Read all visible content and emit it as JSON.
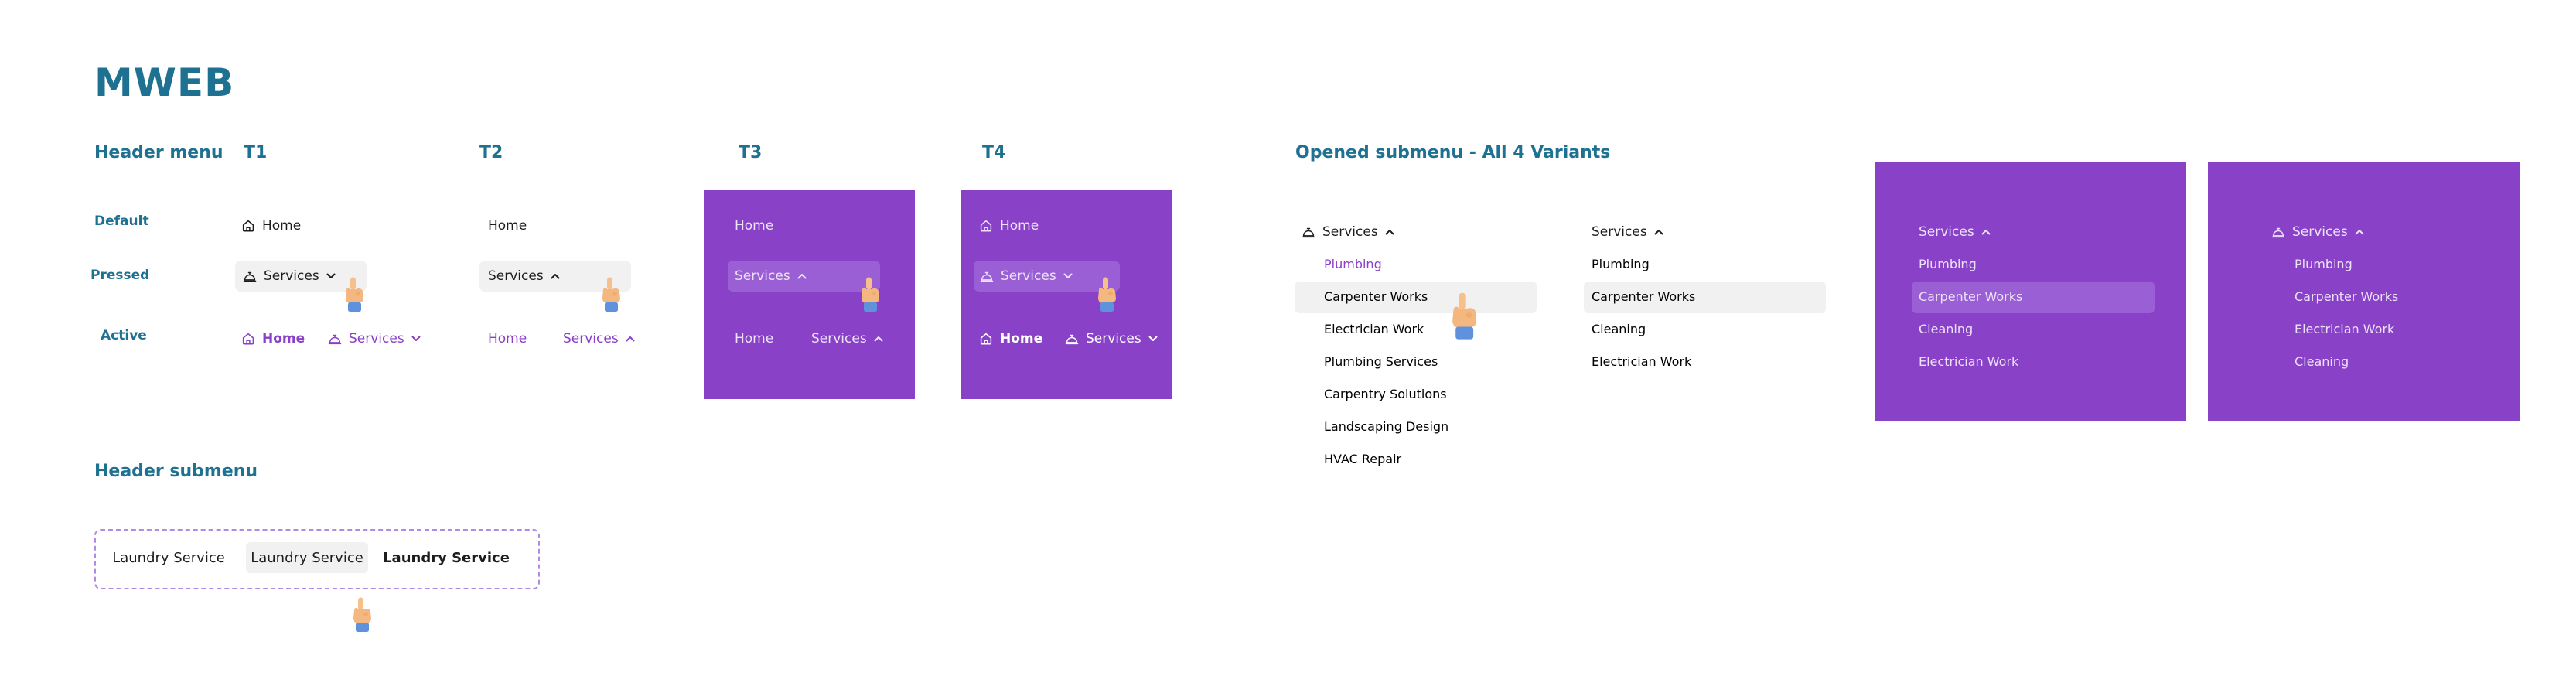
{
  "page_title": "MWEB",
  "sections": {
    "header_menu": "Header menu",
    "t1": "T1",
    "t2": "T2",
    "t3": "T3",
    "t4": "T4",
    "opened_submenu": "Opened submenu - All 4 Variants",
    "header_submenu": "Header submenu"
  },
  "row_labels": {
    "default": "Default",
    "pressed": "Pressed",
    "active": "Active"
  },
  "nav": {
    "home": "Home",
    "services": "Services"
  },
  "submenu_variant_1": [
    "Plumbing",
    "Carpenter Works",
    "Electrician Work",
    "Plumbing Services",
    "Carpentry Solutions",
    "Landscaping Design",
    "HVAC Repair"
  ],
  "submenu_variant_2": [
    "Plumbing",
    "Carpenter Works",
    "Cleaning",
    "Electrician Work"
  ],
  "submenu_variant_3": [
    "Plumbing",
    "Carpenter Works",
    "Cleaning",
    "Electrician Work"
  ],
  "submenu_variant_4": [
    "Plumbing",
    "Carpenter Works",
    "Electrician Work",
    "Cleaning"
  ],
  "header_submenu_items": [
    "Laundry Service",
    "Laundry Service",
    "Laundry Service"
  ],
  "colors": {
    "accent_purple": "#8a3ec9",
    "panel_purple": "#8941c8",
    "heading_teal": "#1e7191",
    "pressed_light": "#f1f1f1",
    "pressed_dark": "#9a5fd5"
  },
  "icons": {
    "home": "home-icon",
    "services": "services-cloche-icon",
    "chevron_down": "chevron-down-icon",
    "chevron_up": "chevron-up-icon",
    "cursor": "pointing-hand-cursor"
  }
}
